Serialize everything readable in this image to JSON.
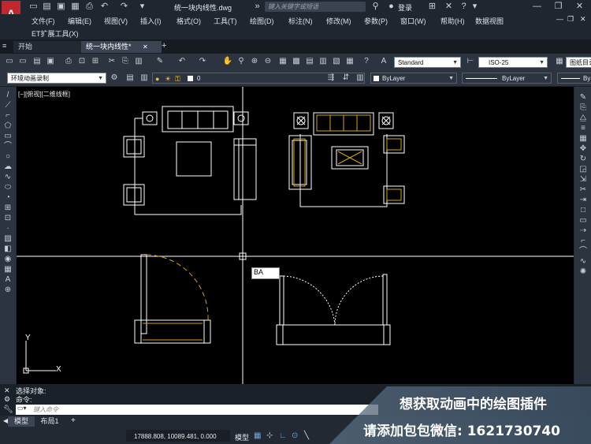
{
  "app": {
    "document_title": "统一块内线性.dwg",
    "search_placeholder": "键入关键字或短语",
    "login_label": "登录"
  },
  "menu": [
    "文件(F)",
    "编辑(E)",
    "视图(V)",
    "插入(I)",
    "格式(O)",
    "工具(T)",
    "绘图(D)",
    "标注(N)",
    "修改(M)",
    "参数(P)",
    "窗口(W)",
    "帮助(H)",
    "数据视图"
  ],
  "et_menu": "ET扩展工具(X)",
  "tabs": {
    "start": "开始",
    "drawing": "统一块内线性*",
    "close": "✕",
    "add": "+"
  },
  "toolbar": {
    "text_style": "Standard",
    "dim_style": "ISO-25",
    "table_style": "图纸目录",
    "workspace": "环境动画录制",
    "layer": "0",
    "color": "ByLayer",
    "linetype": "ByLayer",
    "lineweight": "By"
  },
  "viewport_label": "[−][俯视][二维线框]",
  "dynamic_input": "BA",
  "ucs": {
    "x": "X",
    "y": "Y"
  },
  "command": {
    "output1": "选择对象:",
    "output2": "命令:",
    "placeholder": "键入命令"
  },
  "layout_tabs": [
    "模型",
    "布局1",
    "+"
  ],
  "status": {
    "coordinates": "17888.808, 10089.481, 0.000",
    "model": "模型"
  },
  "ad": {
    "line1": "想获取动画中的绘图插件",
    "line2": "请添加包包微信: 1621730740"
  },
  "colors": {
    "canvas": "#000000",
    "line": "#ffffff",
    "accent": "#d8a020"
  }
}
